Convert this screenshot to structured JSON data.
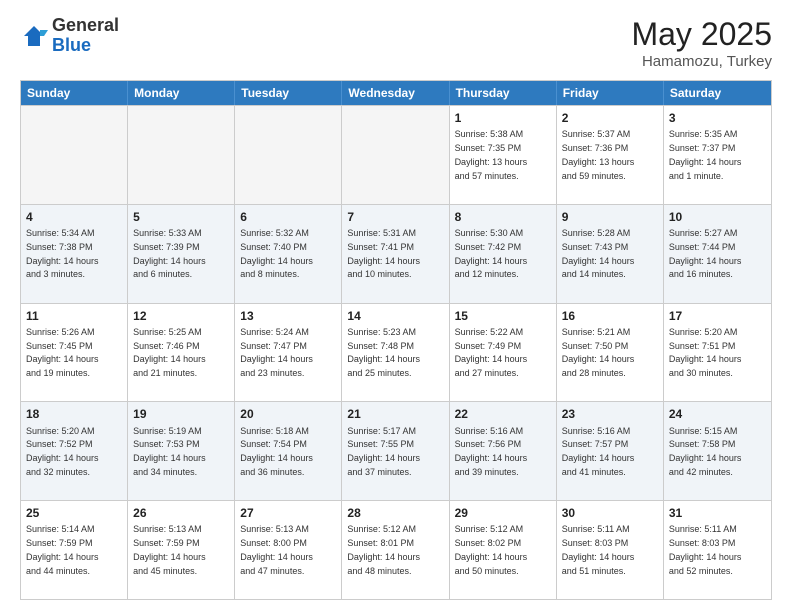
{
  "logo": {
    "general": "General",
    "blue": "Blue"
  },
  "header": {
    "month": "May 2025",
    "location": "Hamamozu, Turkey"
  },
  "weekdays": [
    "Sunday",
    "Monday",
    "Tuesday",
    "Wednesday",
    "Thursday",
    "Friday",
    "Saturday"
  ],
  "rows": [
    [
      {
        "day": "",
        "text": "",
        "empty": true
      },
      {
        "day": "",
        "text": "",
        "empty": true
      },
      {
        "day": "",
        "text": "",
        "empty": true
      },
      {
        "day": "",
        "text": "",
        "empty": true
      },
      {
        "day": "1",
        "text": "Sunrise: 5:38 AM\nSunset: 7:35 PM\nDaylight: 13 hours\nand 57 minutes.",
        "empty": false
      },
      {
        "day": "2",
        "text": "Sunrise: 5:37 AM\nSunset: 7:36 PM\nDaylight: 13 hours\nand 59 minutes.",
        "empty": false
      },
      {
        "day": "3",
        "text": "Sunrise: 5:35 AM\nSunset: 7:37 PM\nDaylight: 14 hours\nand 1 minute.",
        "empty": false
      }
    ],
    [
      {
        "day": "4",
        "text": "Sunrise: 5:34 AM\nSunset: 7:38 PM\nDaylight: 14 hours\nand 3 minutes.",
        "empty": false
      },
      {
        "day": "5",
        "text": "Sunrise: 5:33 AM\nSunset: 7:39 PM\nDaylight: 14 hours\nand 6 minutes.",
        "empty": false
      },
      {
        "day": "6",
        "text": "Sunrise: 5:32 AM\nSunset: 7:40 PM\nDaylight: 14 hours\nand 8 minutes.",
        "empty": false
      },
      {
        "day": "7",
        "text": "Sunrise: 5:31 AM\nSunset: 7:41 PM\nDaylight: 14 hours\nand 10 minutes.",
        "empty": false
      },
      {
        "day": "8",
        "text": "Sunrise: 5:30 AM\nSunset: 7:42 PM\nDaylight: 14 hours\nand 12 minutes.",
        "empty": false
      },
      {
        "day": "9",
        "text": "Sunrise: 5:28 AM\nSunset: 7:43 PM\nDaylight: 14 hours\nand 14 minutes.",
        "empty": false
      },
      {
        "day": "10",
        "text": "Sunrise: 5:27 AM\nSunset: 7:44 PM\nDaylight: 14 hours\nand 16 minutes.",
        "empty": false
      }
    ],
    [
      {
        "day": "11",
        "text": "Sunrise: 5:26 AM\nSunset: 7:45 PM\nDaylight: 14 hours\nand 19 minutes.",
        "empty": false
      },
      {
        "day": "12",
        "text": "Sunrise: 5:25 AM\nSunset: 7:46 PM\nDaylight: 14 hours\nand 21 minutes.",
        "empty": false
      },
      {
        "day": "13",
        "text": "Sunrise: 5:24 AM\nSunset: 7:47 PM\nDaylight: 14 hours\nand 23 minutes.",
        "empty": false
      },
      {
        "day": "14",
        "text": "Sunrise: 5:23 AM\nSunset: 7:48 PM\nDaylight: 14 hours\nand 25 minutes.",
        "empty": false
      },
      {
        "day": "15",
        "text": "Sunrise: 5:22 AM\nSunset: 7:49 PM\nDaylight: 14 hours\nand 27 minutes.",
        "empty": false
      },
      {
        "day": "16",
        "text": "Sunrise: 5:21 AM\nSunset: 7:50 PM\nDaylight: 14 hours\nand 28 minutes.",
        "empty": false
      },
      {
        "day": "17",
        "text": "Sunrise: 5:20 AM\nSunset: 7:51 PM\nDaylight: 14 hours\nand 30 minutes.",
        "empty": false
      }
    ],
    [
      {
        "day": "18",
        "text": "Sunrise: 5:20 AM\nSunset: 7:52 PM\nDaylight: 14 hours\nand 32 minutes.",
        "empty": false
      },
      {
        "day": "19",
        "text": "Sunrise: 5:19 AM\nSunset: 7:53 PM\nDaylight: 14 hours\nand 34 minutes.",
        "empty": false
      },
      {
        "day": "20",
        "text": "Sunrise: 5:18 AM\nSunset: 7:54 PM\nDaylight: 14 hours\nand 36 minutes.",
        "empty": false
      },
      {
        "day": "21",
        "text": "Sunrise: 5:17 AM\nSunset: 7:55 PM\nDaylight: 14 hours\nand 37 minutes.",
        "empty": false
      },
      {
        "day": "22",
        "text": "Sunrise: 5:16 AM\nSunset: 7:56 PM\nDaylight: 14 hours\nand 39 minutes.",
        "empty": false
      },
      {
        "day": "23",
        "text": "Sunrise: 5:16 AM\nSunset: 7:57 PM\nDaylight: 14 hours\nand 41 minutes.",
        "empty": false
      },
      {
        "day": "24",
        "text": "Sunrise: 5:15 AM\nSunset: 7:58 PM\nDaylight: 14 hours\nand 42 minutes.",
        "empty": false
      }
    ],
    [
      {
        "day": "25",
        "text": "Sunrise: 5:14 AM\nSunset: 7:59 PM\nDaylight: 14 hours\nand 44 minutes.",
        "empty": false
      },
      {
        "day": "26",
        "text": "Sunrise: 5:13 AM\nSunset: 7:59 PM\nDaylight: 14 hours\nand 45 minutes.",
        "empty": false
      },
      {
        "day": "27",
        "text": "Sunrise: 5:13 AM\nSunset: 8:00 PM\nDaylight: 14 hours\nand 47 minutes.",
        "empty": false
      },
      {
        "day": "28",
        "text": "Sunrise: 5:12 AM\nSunset: 8:01 PM\nDaylight: 14 hours\nand 48 minutes.",
        "empty": false
      },
      {
        "day": "29",
        "text": "Sunrise: 5:12 AM\nSunset: 8:02 PM\nDaylight: 14 hours\nand 50 minutes.",
        "empty": false
      },
      {
        "day": "30",
        "text": "Sunrise: 5:11 AM\nSunset: 8:03 PM\nDaylight: 14 hours\nand 51 minutes.",
        "empty": false
      },
      {
        "day": "31",
        "text": "Sunrise: 5:11 AM\nSunset: 8:03 PM\nDaylight: 14 hours\nand 52 minutes.",
        "empty": false
      }
    ]
  ]
}
